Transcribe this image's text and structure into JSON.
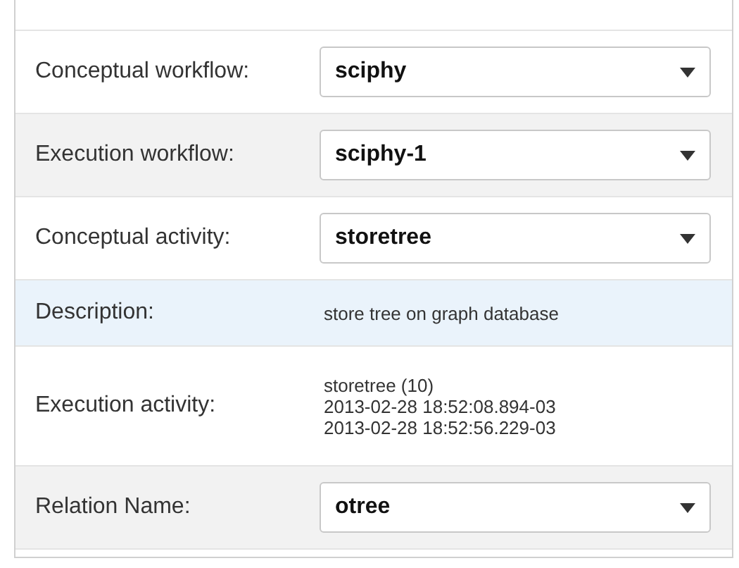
{
  "rows": [
    {
      "kind": "select",
      "label": "Conceptual workflow:",
      "value": "sciphy",
      "color": "#ffffff"
    },
    {
      "kind": "select",
      "label": "Execution workflow:",
      "value": "sciphy-1",
      "color": "#f2f2f2"
    },
    {
      "kind": "select",
      "label": "Conceptual activity:",
      "value": "storetree",
      "color": "#ffffff"
    },
    {
      "kind": "text",
      "label": "Description:",
      "lines": [
        "store tree on graph database"
      ],
      "color": "#eaf3fb"
    },
    {
      "kind": "text",
      "label": "Execution activity:",
      "lines": [
        "storetree (10)",
        "2013-02-28 18:52:08.894-03",
        "2013-02-28 18:52:56.229-03"
      ],
      "color": "#ffffff"
    },
    {
      "kind": "select",
      "label": "Relation Name:",
      "value": "otree",
      "color": "#f2f2f2"
    }
  ]
}
